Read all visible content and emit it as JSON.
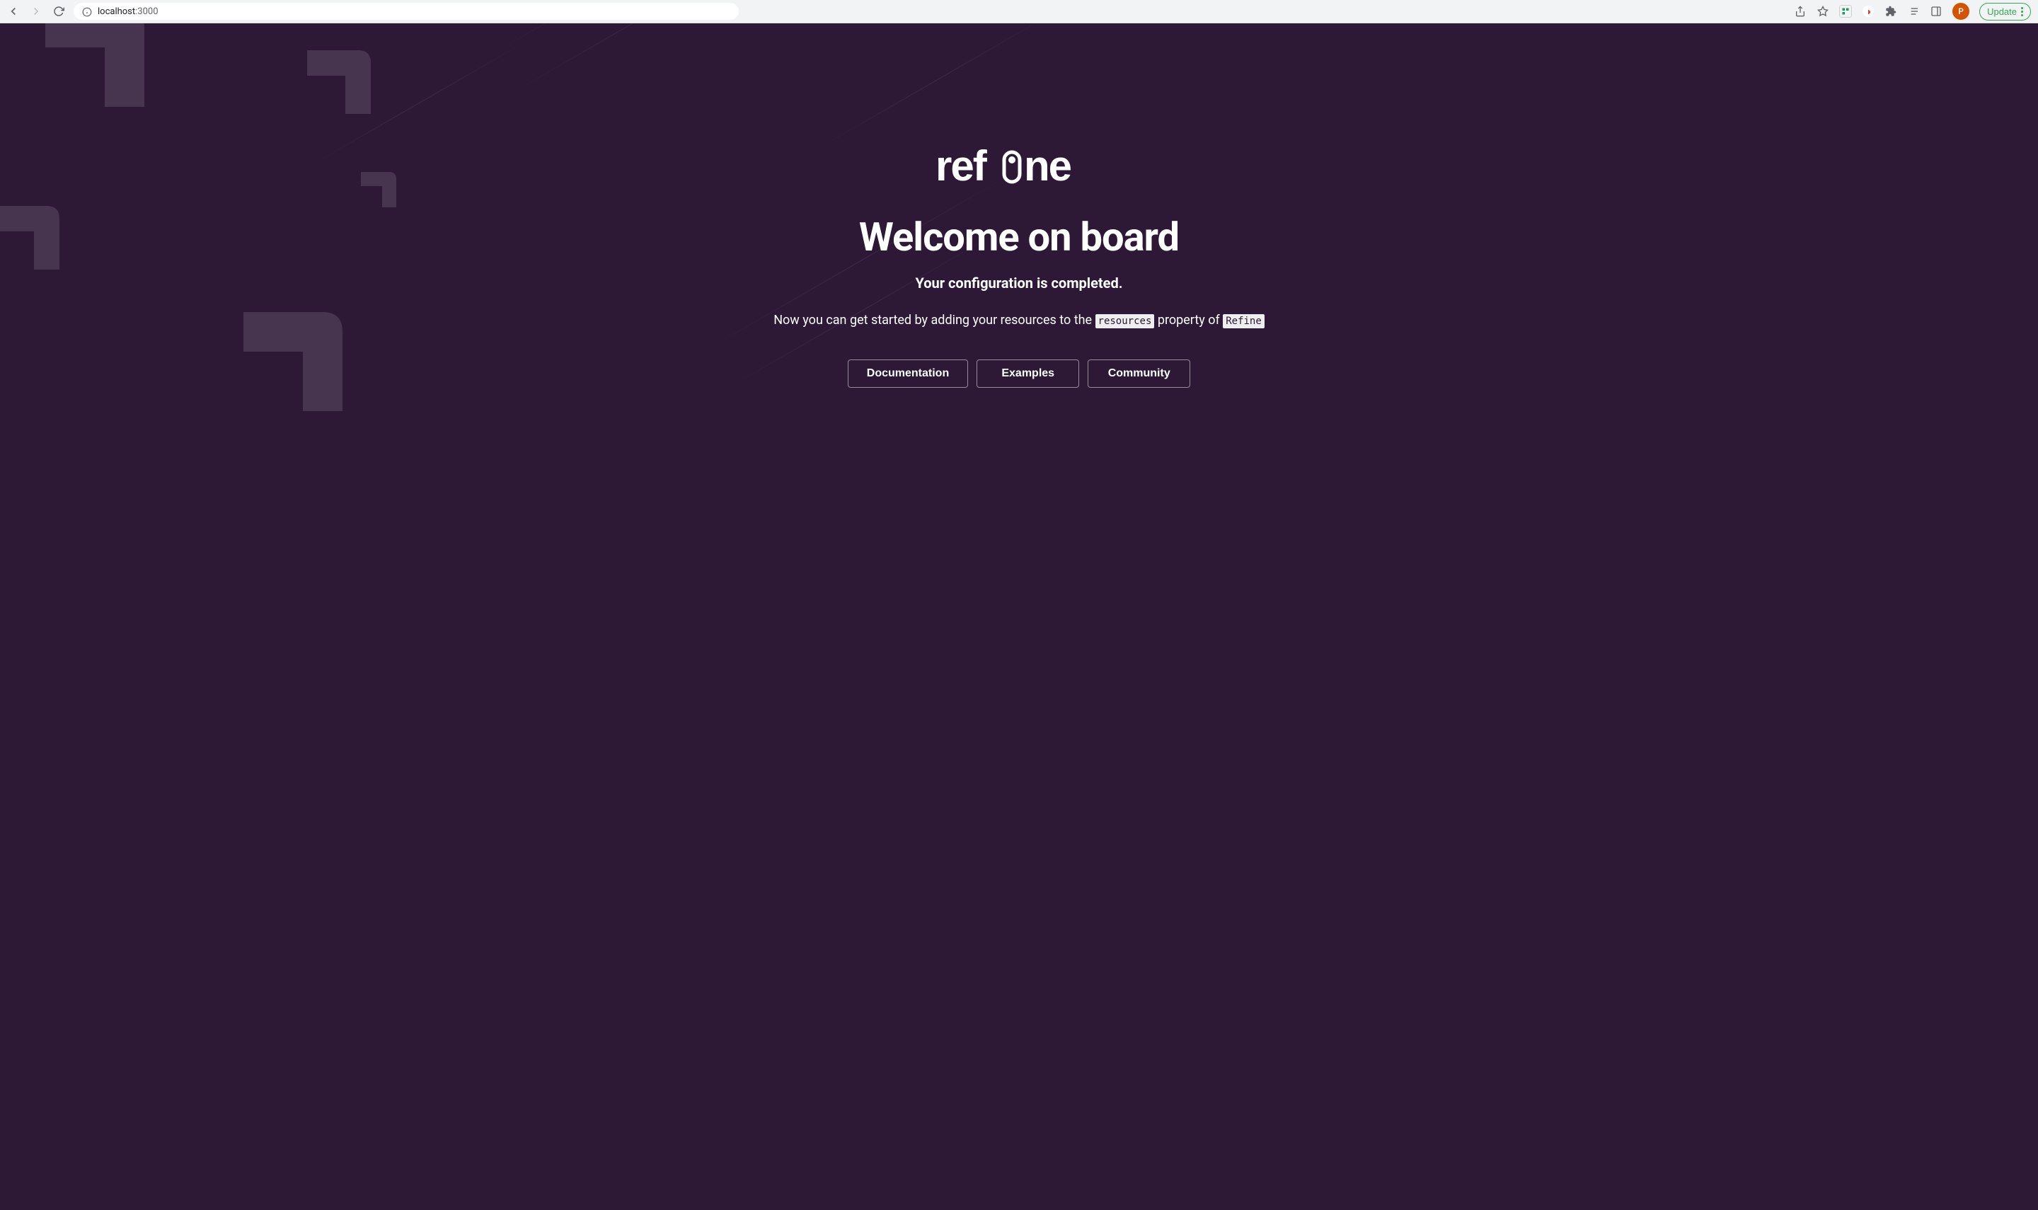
{
  "browser": {
    "url_host": "localhost",
    "url_port": ":3000",
    "update_label": "Update",
    "avatar_initial": "P"
  },
  "page": {
    "logo_text": "refine",
    "heading": "Welcome on board",
    "subtitle": "Your configuration is completed.",
    "description_prefix": "Now you can get started by adding your resources to the ",
    "code_resources": "resources",
    "description_mid": " property of ",
    "code_refine": "Refine",
    "buttons": {
      "documentation": "Documentation",
      "examples": "Examples",
      "community": "Community"
    }
  }
}
